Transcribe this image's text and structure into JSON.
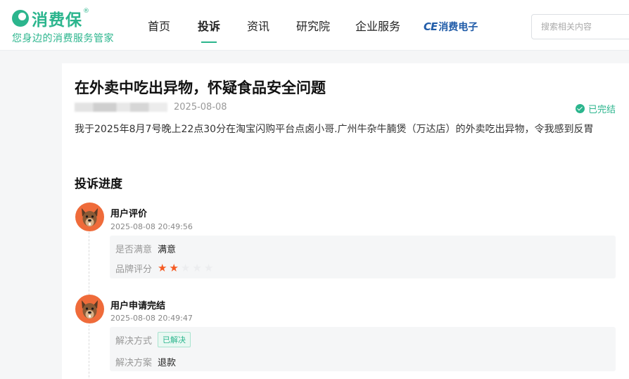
{
  "header": {
    "brand": "消费保",
    "brand_mark": "®",
    "slogan": "您身边的消费服务管家",
    "nav": [
      "首页",
      "投诉",
      "资讯",
      "研究院",
      "企业服务"
    ],
    "active_nav": "投诉",
    "partner_logo": {
      "mark": "CE",
      "text": "消费电子"
    },
    "search_placeholder": "搜索相关内容"
  },
  "complaint": {
    "title": "在外卖中吃出异物，怀疑食品安全问题",
    "date": "2025-08-08",
    "status": "已完结",
    "description": "我于2025年8月7号晚上22点30分在淘宝闪购平台点卤小哥.广州牛杂牛腩煲（万达店）的外卖吃出异物，令我感到反胃"
  },
  "progress": {
    "title": "投诉进度",
    "events": [
      {
        "title": "用户评价",
        "time": "2025-08-08 20:49:56",
        "fields": [
          {
            "label": "是否满意",
            "value": "满意"
          },
          {
            "label": "品牌评分",
            "rating": 2,
            "max": 5
          }
        ]
      },
      {
        "title": "用户申请完结",
        "time": "2025-08-08 20:49:47",
        "fields": [
          {
            "label": "解决方式",
            "tag": "已解决"
          },
          {
            "label": "解决方案",
            "value": "退款"
          }
        ]
      }
    ]
  },
  "colors": {
    "accent": "#2bb58d",
    "star": "#f55b23",
    "partner": "#1f5ba8"
  },
  "icons": [
    "check-circle-icon",
    "dog-avatar-icon",
    "star-icon"
  ]
}
